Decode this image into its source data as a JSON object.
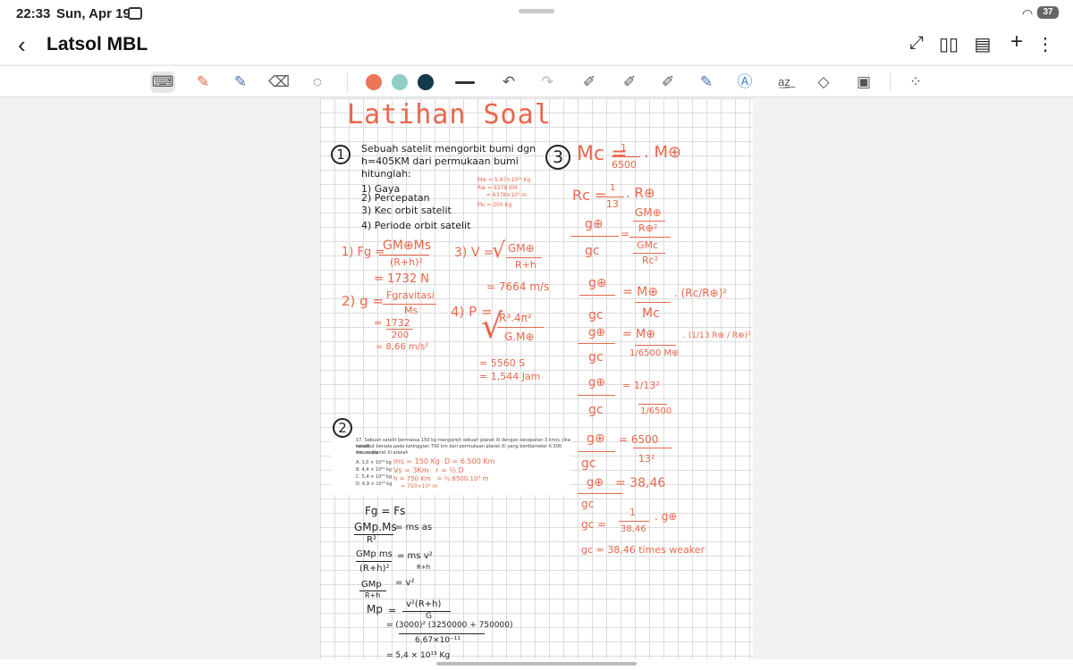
{
  "status": {
    "time": "22:33",
    "date": "Sun, Apr 19",
    "battery": "37"
  },
  "header": {
    "back_icon": "chevron-left-icon",
    "title": "Latsol MBL",
    "icons": [
      "expand-icon",
      "book-icon",
      "doc-settings-icon",
      "add-icon",
      "more-icon"
    ]
  },
  "toolbar": {
    "pen_colors": [
      "#ee7658",
      "#8ecfc4",
      "#13394a"
    ]
  },
  "canvas": {
    "title": "Latihan Soal",
    "q1": {
      "num": "1",
      "lines": [
        "Sebuah satelit mengorbit bumi dgn",
        "h=405KM dari permukaan bumi",
        "hitunglah:",
        "1) Gaya",
        "2) Percepatan",
        "3) Kec orbit satelit",
        "4) Periode orbit satelit"
      ],
      "consts": [
        "M⊕ = 5,97×10²⁴ Kg",
        "R⊕ = 6378 KM",
        "= 6378×10³ m",
        "Ms = 200 Kg"
      ]
    },
    "sol1": {
      "fg_label": "1) Fg =",
      "fg_num": "GM⊕Ms",
      "fg_den": "(R+h)²",
      "fg_res": "= 1732 N",
      "g_label": "2) g =",
      "g_num": "Fgravitasi",
      "g_den": "Ms",
      "g_eq1": "= 1732",
      "g_eq1_den": "200",
      "g_res": "= 8,66 m/s²",
      "v_label": "3) V =",
      "v_num": "GM⊕",
      "v_den": "R+h",
      "v_res": "= 7664 m/s",
      "p_label": "4) P =",
      "p_num": "R³.4π²",
      "p_den": "G.M⊕",
      "p_res1": "= 5560 S",
      "p_res2": "= 1,544 Jam"
    },
    "q2": {
      "num": "2",
      "problem": [
        "17. Sebuah satelit bermassa 150 kg mengorbit sebuah planet Xi dengan kecepatan 3 km/s. Jika satelit",
        "tersebut berada pada ketinggian 750 km dari permukaan planet Xi yang berdiameter 6.500 km, maka",
        "massa planet Xi adalah"
      ],
      "options": [
        "A. 1,0 × 10²³ kg",
        "B. 4,4 × 10²³ kg",
        "C. 5,4 × 10²³ kg",
        "D. 6,9 × 10²³ kg"
      ],
      "notes": [
        "ms = 150 Kg  D = 6.500 Km",
        "Vs = 3Km   r = ½.D",
        "h = 750 Km   = ½.6500.10³ m",
        "= 750×10³ m"
      ],
      "work": [
        "Fg = Fs",
        "GMp.Ms",
        "= ms as",
        "R²",
        "GMp ms",
        "= ms v²",
        "(R+h)²",
        "R+h",
        "GMp",
        "= v²",
        "R+h",
        "Mp",
        "=",
        "v²(R+h)",
        "G",
        "= (3000)² (3250000 + 750000)",
        "6,67×10⁻¹¹",
        "= 5,4 × 10¹³ Kg"
      ]
    },
    "q3": {
      "num": "3",
      "mc_label": "Mc =",
      "mc_num": "1",
      "mc_den": "6500",
      "mc_tail": ". M⊕",
      "rc_label": "Rc =",
      "rc_num": "1",
      "rc_den": "13",
      "rc_tail": ". R⊕",
      "steps": [
        "g⊕",
        "gc",
        "=",
        "GM⊕",
        "R⊕²",
        "GMc",
        "Rc²",
        "g⊕",
        "gc",
        "= M⊕",
        "Mc",
        ". (Rc/R⊕)²",
        "g⊕",
        "gc",
        "= M⊕",
        "1/6500 M⊕",
        ". (1/13 R⊕ / R⊕)²",
        "g⊕",
        "gc",
        "= 1/13²",
        "1/6500",
        "g⊕",
        "gc",
        "= 6500",
        "13²",
        "g⊕",
        "gc",
        "= 38,46",
        "gc =",
        "1",
        "38,46",
        ". g⊕",
        "gc = 38,46 times weaker"
      ]
    }
  }
}
